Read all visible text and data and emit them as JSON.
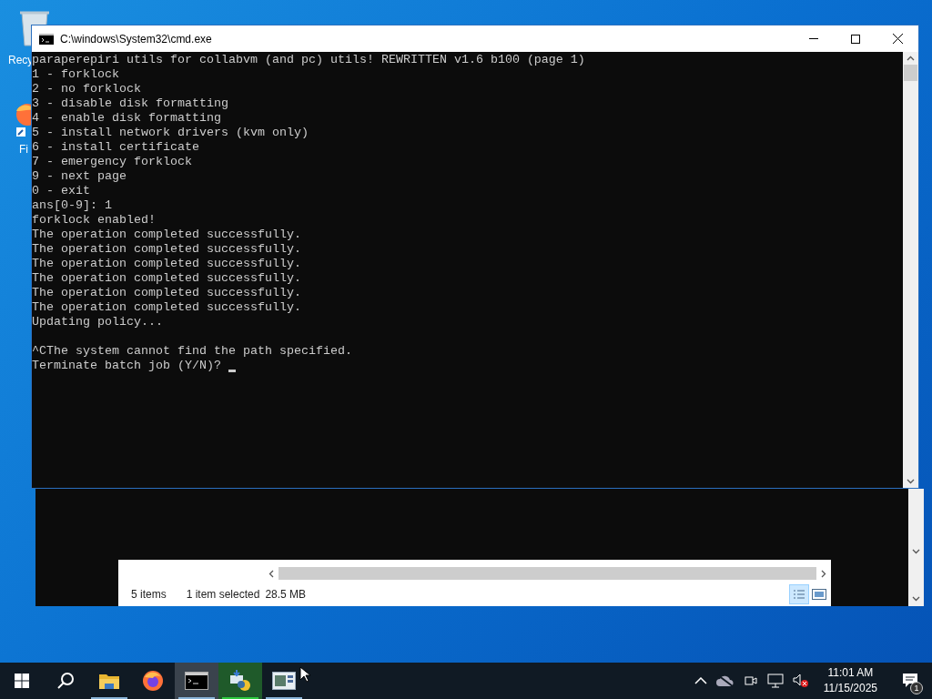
{
  "desktop_icons": [
    {
      "label": "Recy"
    },
    {
      "label": "Fi"
    }
  ],
  "explorer": {
    "status_items": "5 items",
    "status_selected": "1 item selected",
    "status_size": "28.5 MB"
  },
  "console": {
    "title": "C:\\windows\\System32\\cmd.exe",
    "blocks": [
      [
        "paraperepiri utils for collabvm (and pc) utils! REWRITTEN v1.6 b100 (page 1)",
        "1 - forklock",
        "2 - no forklock",
        "3 - disable disk formatting",
        "4 - enable disk formatting",
        "5 - install network drivers (kvm only)",
        "6 - install certificate",
        "7 - emergency forklock",
        "9 - next page",
        "0 - exit",
        "ans[0-9]: 1",
        "forklock enabled!",
        "The operation completed successfully.",
        "The operation completed successfully.",
        "The operation completed successfully.",
        "The operation completed successfully.",
        "The operation completed successfully.",
        "The operation completed successfully.",
        "Updating policy..."
      ],
      [
        "^CThe system cannot find the path specified.",
        "Terminate batch job (Y/N)? "
      ]
    ],
    "cursor": true
  },
  "taskbar": {
    "apps": [
      {
        "kind": "explorer",
        "running": true,
        "selected": false
      },
      {
        "kind": "firefox",
        "running": false,
        "selected": false
      },
      {
        "kind": "console",
        "running": true,
        "selected": true
      },
      {
        "kind": "python",
        "running": true,
        "selected": false
      },
      {
        "kind": "window",
        "running": true,
        "selected": false
      }
    ],
    "time": "11:01 AM",
    "date": "11/15/2025",
    "notifications": "1"
  }
}
